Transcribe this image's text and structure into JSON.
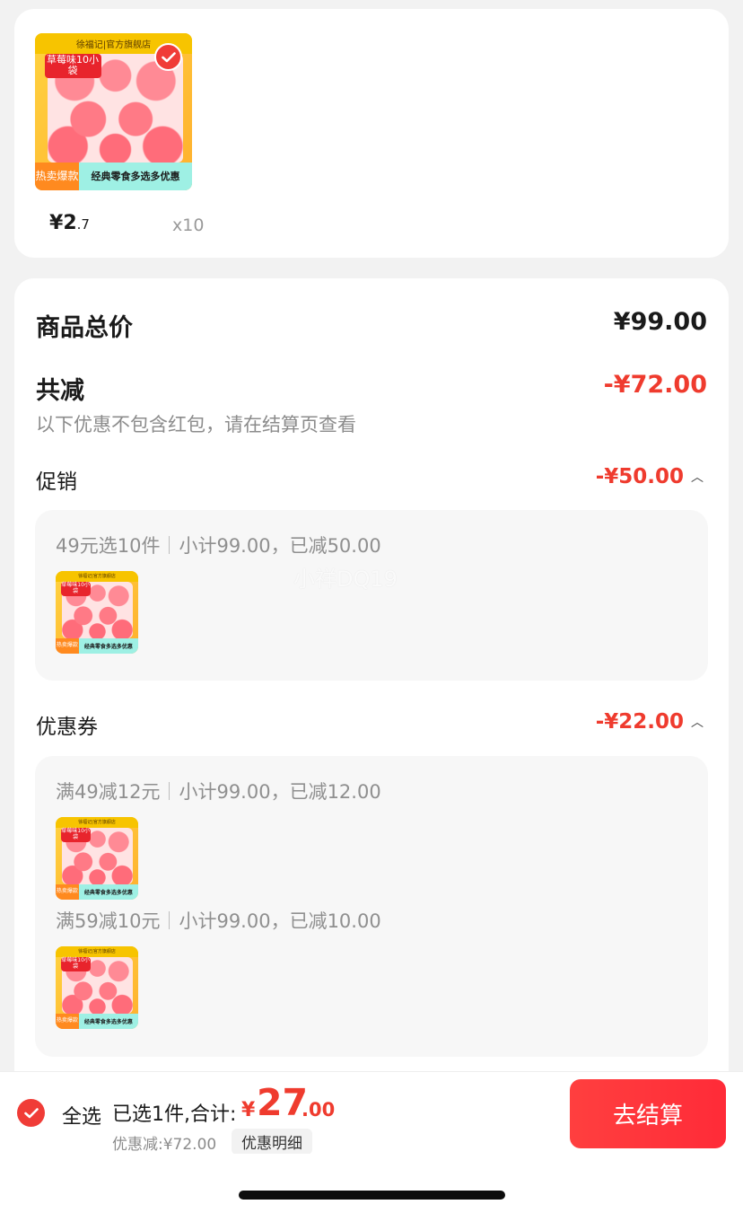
{
  "product": {
    "brand_text": "徐福记|官方旗舰店",
    "flavor_text": "草莓味10小袋",
    "hot_text": "热卖爆款",
    "slogan_text": "经典零食多选多优惠",
    "price_symbol": "¥",
    "price_int": "2",
    "price_dec": ".7",
    "quantity": "x10"
  },
  "summary": {
    "total_label": "商品总价",
    "total_value": "¥99.00",
    "reduce_label": "共减",
    "reduce_value": "-¥72.00",
    "hint": "以下优惠不包含红包，请在结算页查看"
  },
  "promotion": {
    "label": "促销",
    "value": "-¥50.00",
    "rule": "49元选10件",
    "subtotal": "小计99.00，已减50.00"
  },
  "coupon": {
    "label": "优惠券",
    "value": "-¥22.00",
    "rules": [
      {
        "rule": "满49减12元",
        "subtotal": "小计99.00，已减12.00"
      },
      {
        "rule": "满59减10元",
        "subtotal": "小计99.00，已减10.00"
      }
    ]
  },
  "watermark": "小祥DQ19",
  "bottom_bar": {
    "select_all": "全选",
    "selected_info": "已选1件,合计:",
    "total_symbol": "¥",
    "total_int": "27",
    "total_dec": ".00",
    "discount_note": "优惠减:¥72.00",
    "detail_button": "优惠明细",
    "checkout_button": "去结算"
  },
  "colors": {
    "accent_red": "#ef3b2e",
    "button_red": "#ff2b38",
    "page_bg": "#f2f2f2"
  }
}
